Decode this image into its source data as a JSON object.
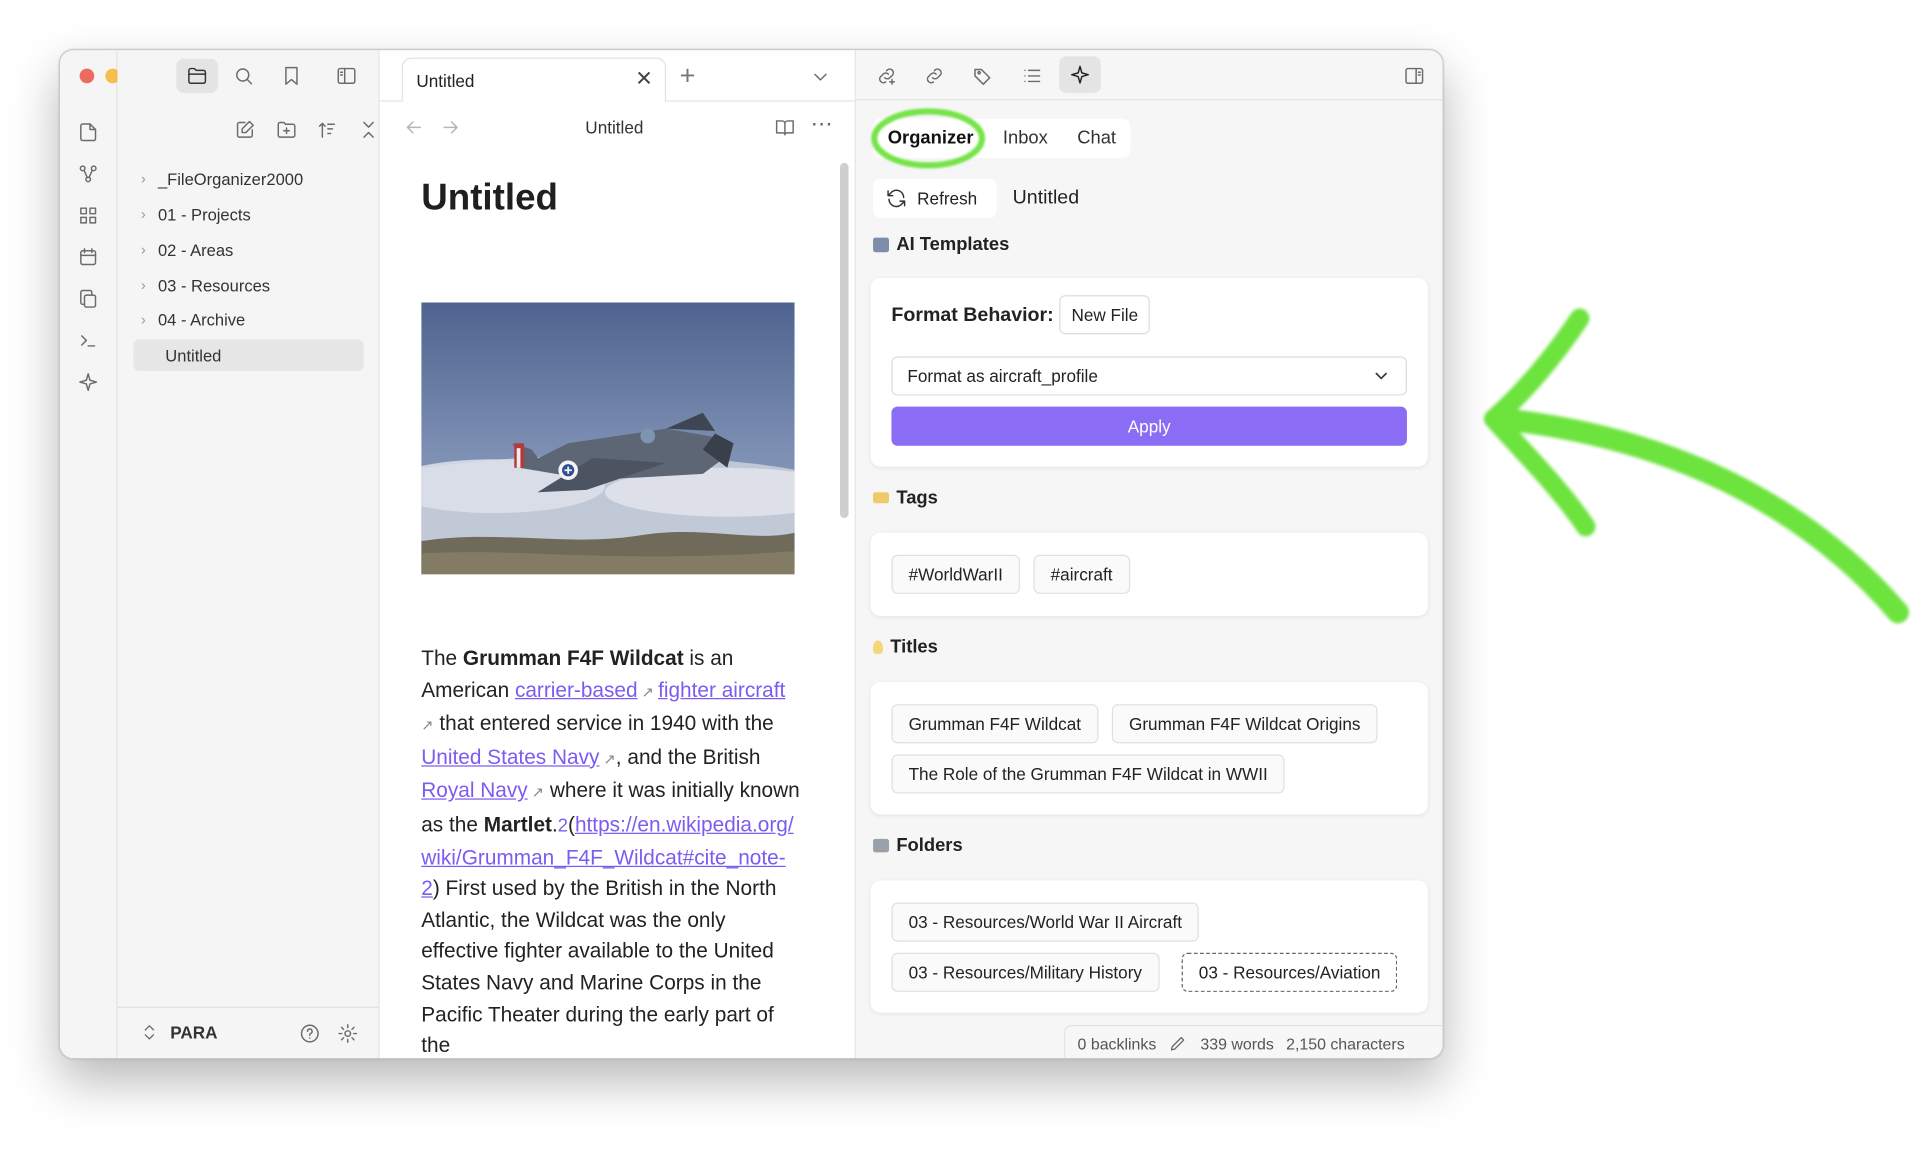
{
  "sidebar": {
    "tree": [
      {
        "label": "_FileOrganizer2000",
        "folder": true
      },
      {
        "label": "01 - Projects",
        "folder": true
      },
      {
        "label": "02 - Areas",
        "folder": true
      },
      {
        "label": "03 - Resources",
        "folder": true
      },
      {
        "label": "04 - Archive",
        "folder": true
      },
      {
        "label": "Untitled",
        "folder": false
      }
    ],
    "vault_name": "PARA"
  },
  "editor": {
    "tab_title": "Untitled",
    "header_title": "Untitled",
    "doc_title": "Untitled",
    "p": {
      "t1": "The ",
      "b1": "Grumman F4F Wildcat",
      "t2": " is an American ",
      "l1": "carrier-based",
      "l2": "fighter aircraft",
      "t3": " that entered service in 1940 with the ",
      "l3": "United States Navy",
      "t4": ", and the British ",
      "l4": "Royal Navy",
      "t5": " where it was initially known as the ",
      "b2": "Martlet",
      "t6": ".",
      "sup": "2",
      "t7": "(",
      "l5": "https://en.wikipedia.org/wiki/Grumman_F4F_Wildcat#cite_note-2",
      "t8": ") First used by the British in the North Atlantic, the Wildcat was the only effective fighter available to the United States Navy and Marine Corps in the Pacific Theater during the early part of the"
    }
  },
  "organizer": {
    "tabs": [
      "Organizer",
      "Inbox",
      "Chat"
    ],
    "refresh_label": "Refresh",
    "note_name": "Untitled",
    "ai_templates": {
      "heading": "AI Templates",
      "format_behavior_label": "Format Behavior:",
      "format_behavior_value": "New File",
      "selected_template": "Format as aircraft_profile",
      "apply_label": "Apply"
    },
    "tags": {
      "heading": "Tags",
      "items": [
        "#WorldWarII",
        "#aircraft"
      ]
    },
    "titles": {
      "heading": "Titles",
      "items": [
        "Grumman F4F Wildcat",
        "Grumman F4F Wildcat Origins",
        "The Role of the Grumman F4F Wildcat in WWII"
      ]
    },
    "folders": {
      "heading": "Folders",
      "items": [
        "03 - Resources/World War II Aircraft",
        "03 - Resources/Military History",
        "03 - Resources/Aviation"
      ]
    }
  },
  "status_bar": {
    "backlinks": "0 backlinks",
    "words": "339 words",
    "characters": "2,150 characters"
  },
  "colors": {
    "accent": "#8b6cf5",
    "annotation_green": "#5ee02a",
    "close": "#ed6a5e",
    "minimize": "#f5bf4f",
    "maximize": "#61c554"
  }
}
